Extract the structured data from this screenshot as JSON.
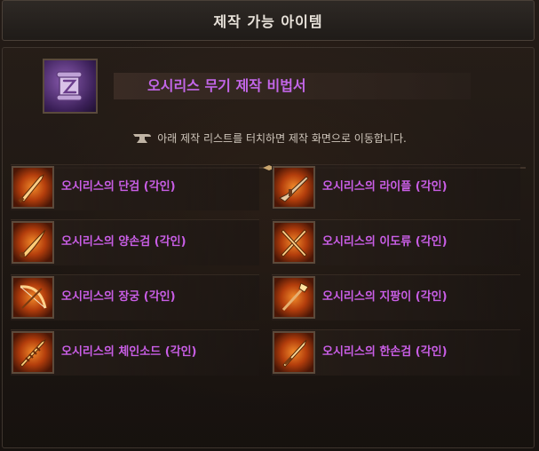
{
  "header": {
    "title": "제작 가능 아이템"
  },
  "recipe": {
    "name": "오시리스 무기 제작 비법서",
    "icon": "scroll-icon"
  },
  "hint": {
    "text": "아래 제작 리스트를 터치하면 제작 화면으로 이동합니다.",
    "icon": "anvil-icon"
  },
  "items": [
    {
      "label": "오시리스의 단검 (각인)",
      "icon": "dagger-icon"
    },
    {
      "label": "오시리스의 라이플 (각인)",
      "icon": "rifle-icon"
    },
    {
      "label": "오시리스의 양손검 (각인)",
      "icon": "two-handed-sword-icon"
    },
    {
      "label": "오시리스의 이도류 (각인)",
      "icon": "dual-blades-icon"
    },
    {
      "label": "오시리스의 장궁 (각인)",
      "icon": "longbow-icon"
    },
    {
      "label": "오시리스의 지팡이 (각인)",
      "icon": "staff-icon"
    },
    {
      "label": "오시리스의 체인소드 (각인)",
      "icon": "chain-sword-icon"
    },
    {
      "label": "오시리스의 한손검 (각인)",
      "icon": "one-handed-sword-icon"
    }
  ],
  "colors": {
    "item_text": "#c95ee6",
    "recipe_text": "#c266e8",
    "thumb_glow": "#f08a2a"
  }
}
